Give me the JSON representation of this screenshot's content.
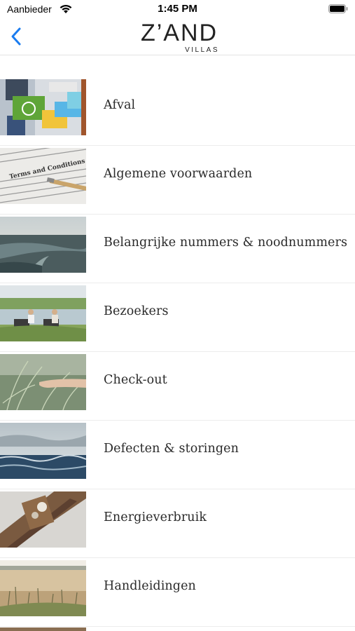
{
  "status_bar": {
    "carrier": "Aanbieder",
    "time": "1:45 PM"
  },
  "nav": {
    "logo_main": "Z’AND",
    "logo_sub": "VILLAS",
    "accent_color": "#1a7cf0"
  },
  "items": [
    {
      "label": "Afval",
      "icon": "recycling-photo-icon"
    },
    {
      "label": "Algemene voorwaarden",
      "icon": "terms-document-photo-icon"
    },
    {
      "label": "Belangrijke nummers & noodnummers",
      "icon": "tidal-flats-photo-icon"
    },
    {
      "label": "Bezoekers",
      "icon": "visitors-photo-icon"
    },
    {
      "label": "Check-out",
      "icon": "grass-hand-photo-icon"
    },
    {
      "label": "Defecten & storingen",
      "icon": "sea-photo-icon"
    },
    {
      "label": "Energieverbruik",
      "icon": "wood-lantern-photo-icon"
    },
    {
      "label": "Handleidingen",
      "icon": "wheat-field-photo-icon"
    }
  ]
}
